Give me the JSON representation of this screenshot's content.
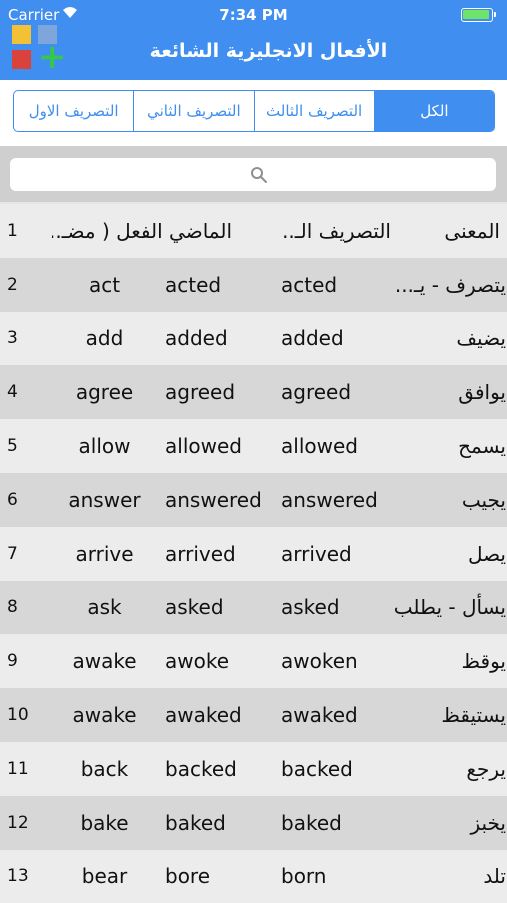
{
  "status_bar": {
    "carrier": "Carrier",
    "time": "7:34 PM"
  },
  "app": {
    "title": "الأفعال الانجليزية الشائعة"
  },
  "logo_colors": [
    "#f2c136",
    "#7fa6db",
    "#d9433c",
    "#37c84b"
  ],
  "accent_color": "#3f8ef0",
  "segments": [
    {
      "label": "الكل",
      "active": true
    },
    {
      "label": "التصريف الثالث",
      "active": false
    },
    {
      "label": "التصريف الثاني",
      "active": false
    },
    {
      "label": "التصريف الاول",
      "active": false
    }
  ],
  "search": {
    "placeholder": ""
  },
  "table": {
    "header": {
      "num": "1",
      "base": "الماضي الفعل ( مضـ...",
      "pp": "التصريف الـ...",
      "meaning": "المعنى"
    },
    "rows": [
      {
        "num": "2",
        "base": "act",
        "past": "acted",
        "pp": "acted",
        "meaning": "يتصرف - يـ..."
      },
      {
        "num": "3",
        "base": "add",
        "past": "added",
        "pp": "added",
        "meaning": "يضيف"
      },
      {
        "num": "4",
        "base": "agree",
        "past": "agreed",
        "pp": "agreed",
        "meaning": "يوافق"
      },
      {
        "num": "5",
        "base": "allow",
        "past": "allowed",
        "pp": "allowed",
        "meaning": "يسمح"
      },
      {
        "num": "6",
        "base": "answer",
        "past": "answered",
        "pp": "answered",
        "meaning": "يجيب"
      },
      {
        "num": "7",
        "base": "arrive",
        "past": "arrived",
        "pp": "arrived",
        "meaning": "يصل"
      },
      {
        "num": "8",
        "base": "ask",
        "past": "asked",
        "pp": "asked",
        "meaning": "يسأل - يطلب"
      },
      {
        "num": "9",
        "base": "awake",
        "past": "awoke",
        "pp": "awoken",
        "meaning": "يوقظ"
      },
      {
        "num": "10",
        "base": "awake",
        "past": "awaked",
        "pp": "awaked",
        "meaning": "يستيقظ"
      },
      {
        "num": "11",
        "base": "back",
        "past": "backed",
        "pp": "backed",
        "meaning": "يرجع"
      },
      {
        "num": "12",
        "base": "bake",
        "past": "baked",
        "pp": "baked",
        "meaning": "يخبز"
      },
      {
        "num": "13",
        "base": "bear",
        "past": "bore",
        "pp": "born",
        "meaning": "تلد"
      }
    ]
  }
}
